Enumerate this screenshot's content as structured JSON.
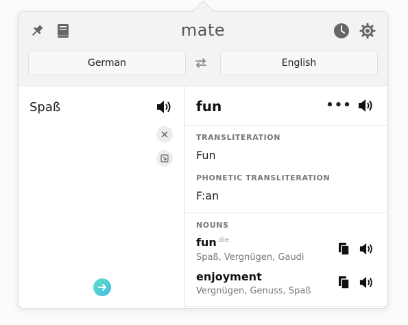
{
  "app": {
    "title": "mate"
  },
  "header": {
    "source_language": "German",
    "target_language": "English",
    "icons": [
      "pin-icon",
      "book-icon",
      "history-clock-icon",
      "settings-gear-icon",
      "swap-icon"
    ]
  },
  "source": {
    "text": "Spaß"
  },
  "result": {
    "translation": "fun",
    "more_label": "•••",
    "transliteration_label": "TRANSLITERATION",
    "transliteration": "Fun",
    "phonetic_label": "PHONETIC TRANSLITERATION",
    "phonetic": "F:an",
    "nouns_label": "NOUNS",
    "nouns": [
      {
        "word": "fun",
        "article": "die",
        "synonyms": "Spaß, Vergnügen, Gaudi"
      },
      {
        "word": "enjoyment",
        "article": "",
        "synonyms": "Vergnügen, Genuss, Spaß"
      }
    ]
  },
  "colors": {
    "accent_start": "#5fe2c0",
    "accent_end": "#43b6e8",
    "header_bg": "#f3f3f3"
  }
}
